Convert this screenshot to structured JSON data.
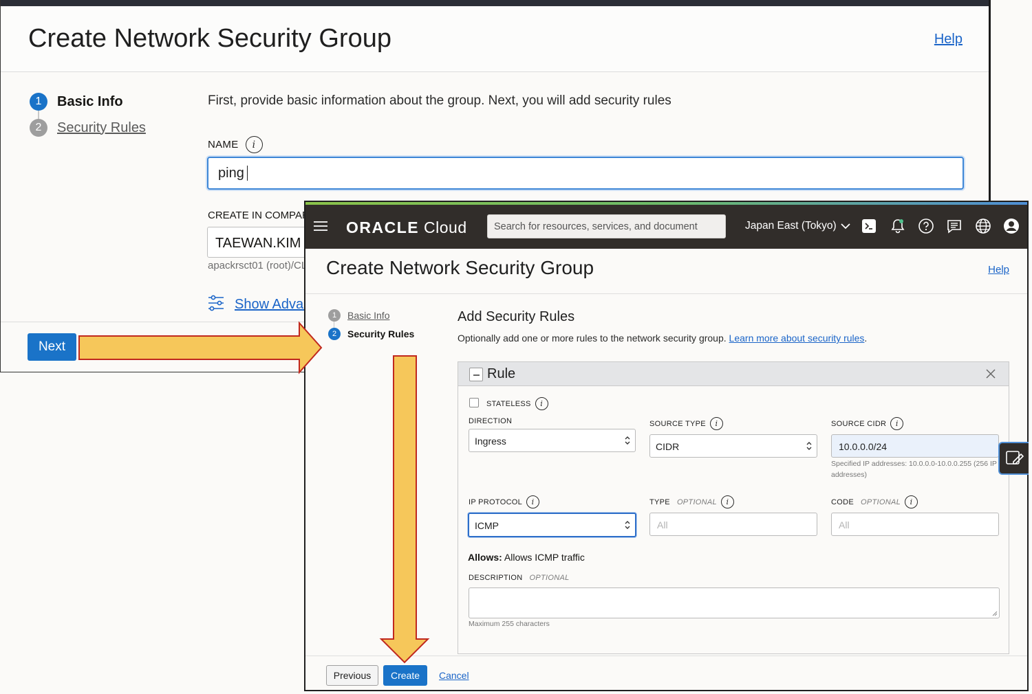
{
  "back_window": {
    "title": "Create Network Security Group",
    "help": "Help",
    "steps": [
      {
        "num": "1",
        "label": "Basic Info"
      },
      {
        "num": "2",
        "label": "Security Rules"
      }
    ],
    "intro": "First, provide basic information about the group. Next, you will add security rules",
    "name_label": "NAME",
    "name_value": "ping",
    "compartment_label": "CREATE IN COMPART",
    "compartment_value": "TAEWAN.KIM",
    "compartment_path": "apackrsct01 (root)/CL",
    "show_advanced": "Show Advar",
    "next": "Next"
  },
  "front_window": {
    "nav": {
      "logo_bold": "ORACLE",
      "logo_light": "Cloud",
      "search_placeholder": "Search for resources, services, and document",
      "region": "Japan East (Tokyo)"
    },
    "title": "Create Network Security Group",
    "help": "Help",
    "steps": [
      {
        "num": "1",
        "label": "Basic Info"
      },
      {
        "num": "2",
        "label": "Security Rules"
      }
    ],
    "section_title": "Add Security Rules",
    "section_desc": "Optionally add one or more rules to the network security group.",
    "learn_more": "Learn more about security rules",
    "period": ".",
    "rule": {
      "title": "Rule",
      "stateless": "STATELESS",
      "direction_label": "DIRECTION",
      "direction_value": "Ingress",
      "source_type_label": "SOURCE TYPE",
      "source_type_value": "CIDR",
      "source_cidr_label": "SOURCE CIDR",
      "source_cidr_value": "10.0.0.0/24",
      "source_cidr_hint": "Specified IP addresses: 10.0.0.0-10.0.0.255 (256 IP addresses)",
      "ip_protocol_label": "IP PROTOCOL",
      "ip_protocol_value": "ICMP",
      "type_label": "TYPE",
      "type_placeholder": "All",
      "code_label": "CODE",
      "code_placeholder": "All",
      "optional": "OPTIONAL",
      "allows_label": "Allows:",
      "allows_text": "Allows ICMP traffic",
      "description_label": "DESCRIPTION",
      "description_hint": "Maximum 255 characters"
    },
    "previous": "Previous",
    "create": "Create",
    "cancel": "Cancel"
  },
  "colors": {
    "accent": "#1a73c8",
    "nav_bg": "#312d2a",
    "arrow_fill": "#f6c75a",
    "arrow_stroke": "#c0281e"
  }
}
